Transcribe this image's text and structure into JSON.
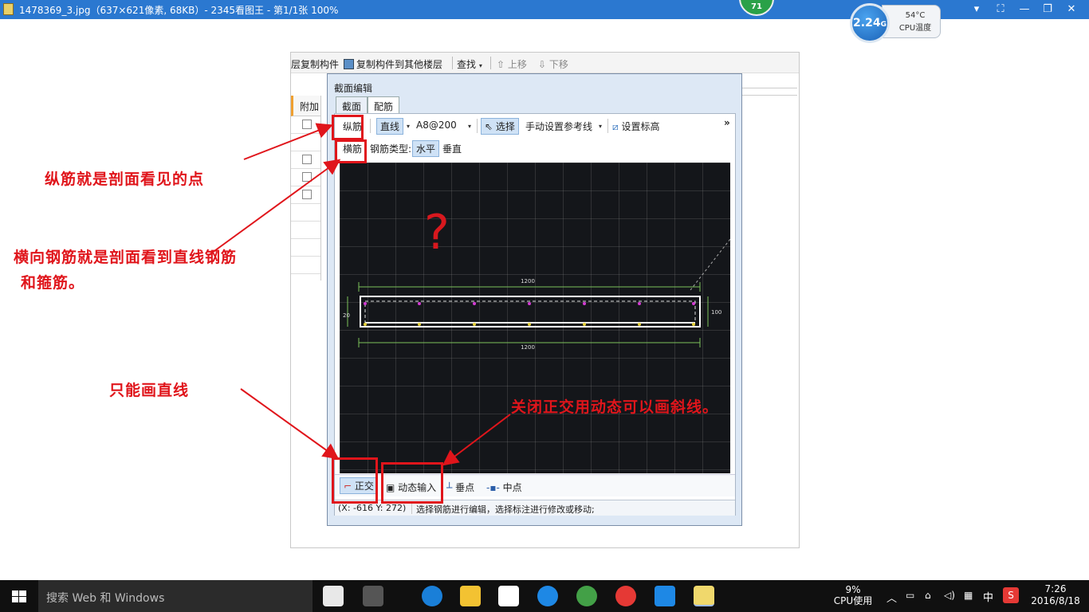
{
  "viewer": {
    "title": "1478369_3.jpg（637×621像素, 68KB）- 2345看图王 - 第1/1张 100%",
    "badge": "71",
    "cpu_widget": {
      "value": "2.24",
      "unit": "G",
      "temp": "54°C",
      "label": "CPU温度"
    }
  },
  "main_toolbar": {
    "items": [
      "层复制构件",
      "复制构件到其他楼层",
      "查找",
      "上移",
      "下移"
    ]
  },
  "bg_table": {
    "header": "附加"
  },
  "dialog": {
    "title": "截面编辑",
    "tabs": [
      "截面",
      "配筋"
    ],
    "toolbar1": {
      "zongjin": "纵筋",
      "line": "直线",
      "spec": "A8@200",
      "select": "选择",
      "manual_ref": "手动设置参考线",
      "set_height": "设置标高",
      "more": "»"
    },
    "toolbar2": {
      "hengjin": "横筋",
      "type_label": "钢筋类型:",
      "horizontal": "水平",
      "vertical": "垂直"
    },
    "drawing": {
      "dim_top": "1200",
      "dim_bottom": "1200",
      "dim_left": "20",
      "dim_right": "100",
      "question_mark": "?"
    },
    "snapbar": [
      "正交",
      "动态输入",
      "垂点",
      "中点"
    ],
    "status": {
      "coords": "(X: -616 Y: 272)",
      "message": "选择钢筋进行编辑，选择标注进行修改或移动;"
    }
  },
  "annotations": {
    "a1": "纵筋就是剖面看见的点",
    "a2_line1": "横向钢筋就是剖面看到直线钢筋",
    "a2_line2": "和箍筋。",
    "a3": "只能画直线",
    "a4": "关闭正交用动态可以画斜线。"
  },
  "taskbar": {
    "search": "搜索 Web 和 Windows",
    "cpu_percent": "9%",
    "cpu_label": "CPU使用",
    "ime": "中",
    "time": "7:26",
    "date": "2016/8/18"
  },
  "colors": {
    "annotation_red": "#e0151b",
    "title_blue": "#2b78d0",
    "taskbar": "#101010",
    "canvas": "#14161a"
  }
}
